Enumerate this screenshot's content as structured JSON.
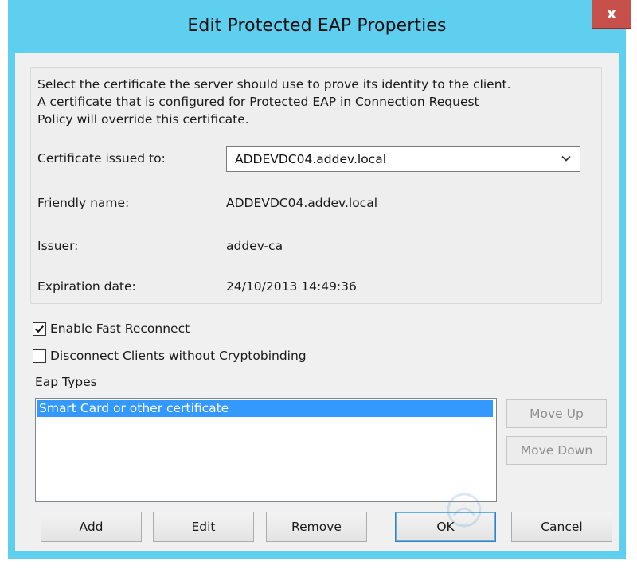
{
  "window": {
    "title": "Edit Protected EAP Properties",
    "close_glyph": "x"
  },
  "description": {
    "line1": "Select the certificate the server should use to prove its identity to the client.",
    "line2": "A certificate that is configured for Protected EAP in Connection Request",
    "line3": "Policy will override this certificate."
  },
  "certificate": {
    "issued_to_label": "Certificate issued to:",
    "issued_to_value": "ADDEVDC04.addev.local",
    "friendly_name_label": "Friendly name:",
    "friendly_name_value": "ADDEVDC04.addev.local",
    "issuer_label": "Issuer:",
    "issuer_value": "addev-ca",
    "expiration_label": "Expiration date:",
    "expiration_value": "24/10/2013 14:49:36"
  },
  "options": {
    "fast_reconnect": {
      "label": "Enable Fast Reconnect",
      "checked": true
    },
    "disconnect_clients": {
      "label": "Disconnect Clients without Cryptobinding",
      "checked": false
    }
  },
  "eap_types": {
    "label": "Eap Types",
    "items": [
      "Smart Card or other certificate"
    ],
    "move_up": "Move Up",
    "move_down": "Move Down"
  },
  "buttons": {
    "add": "Add",
    "edit": "Edit",
    "remove": "Remove",
    "ok": "OK",
    "cancel": "Cancel"
  },
  "colors": {
    "title_bar": "#5fcff0",
    "close_button": "#c7504a",
    "selection": "#3399ff"
  },
  "icons": {
    "close": "close-icon",
    "dropdown": "chevron-down-icon",
    "check": "checkmark-icon"
  }
}
